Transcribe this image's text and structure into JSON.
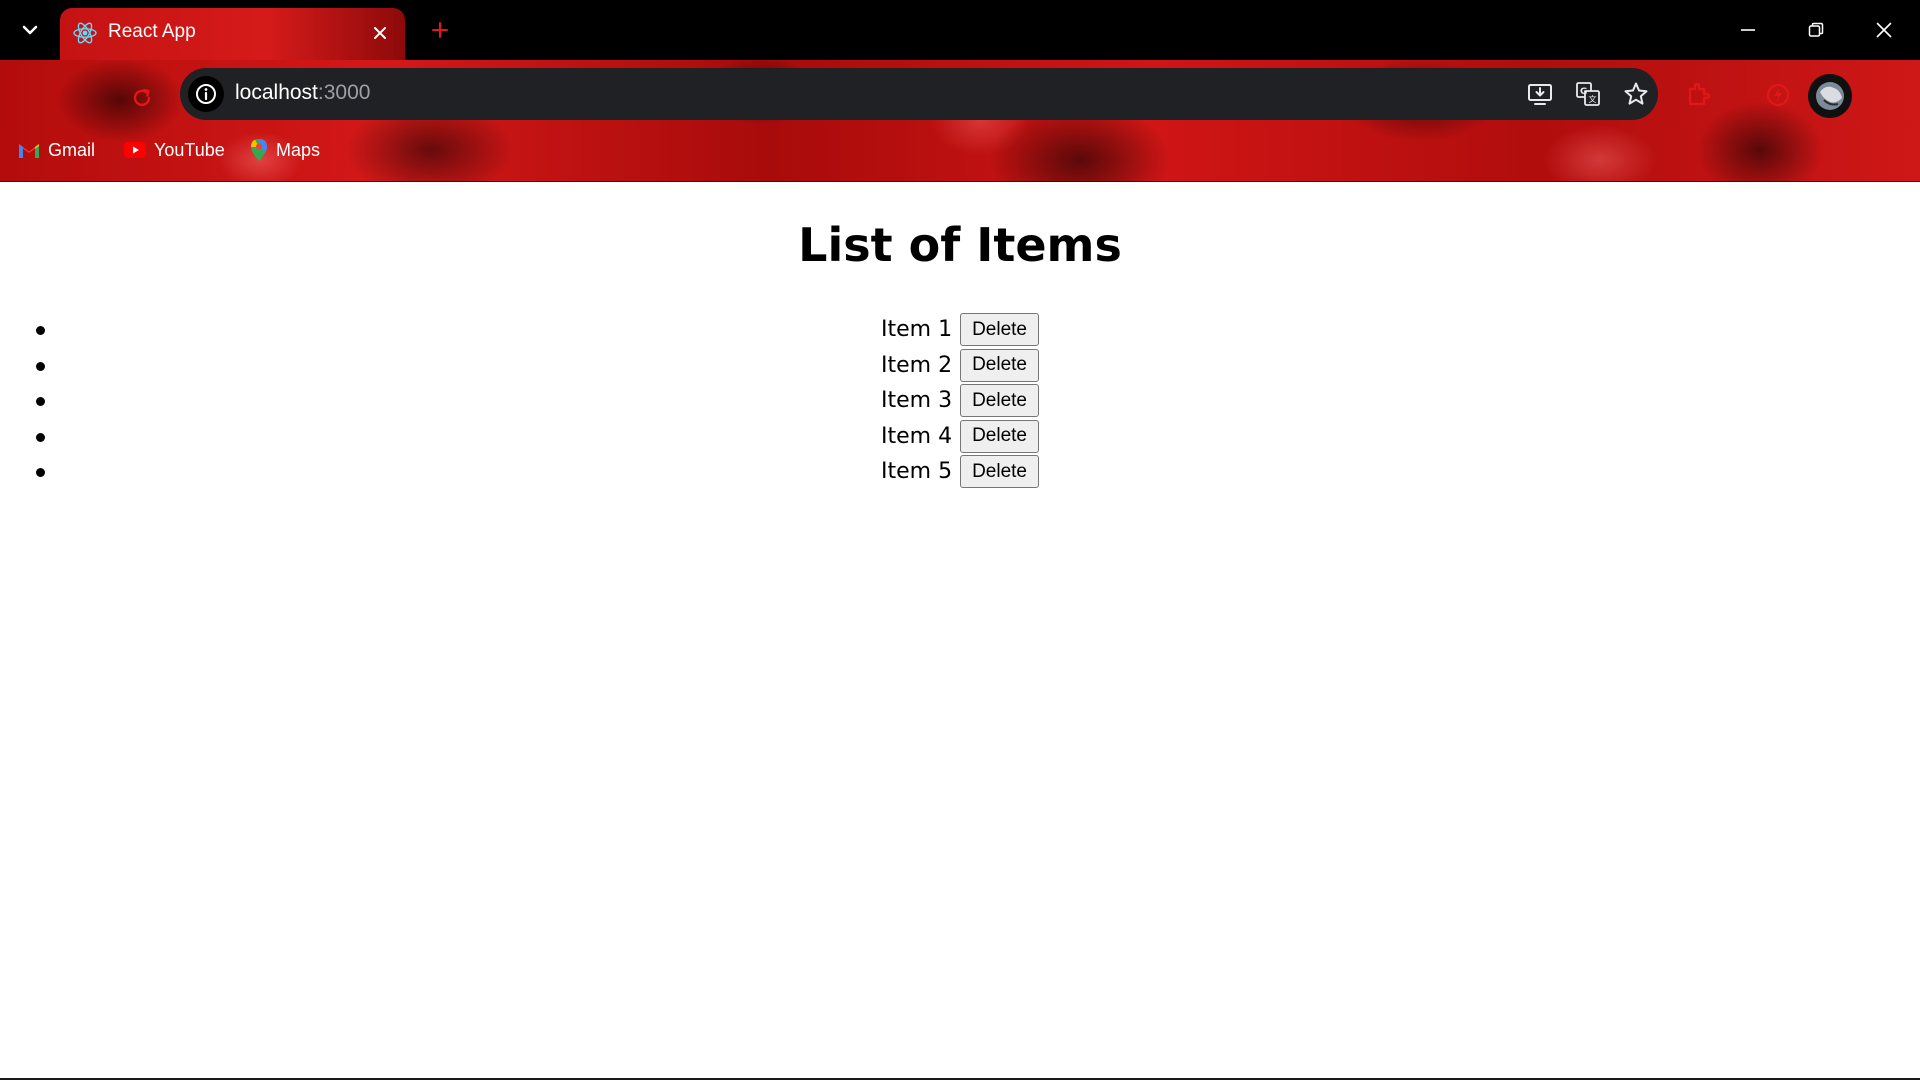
{
  "browser": {
    "tab": {
      "title": "React App",
      "favicon": "react-logo-icon",
      "close_icon": "close-icon"
    },
    "new_tab_icon": "plus-icon",
    "tab_search_icon": "chevron-down-icon",
    "window_controls": [
      "minimize-icon",
      "restore-icon",
      "close-icon"
    ],
    "omnibox": {
      "site_info_icon": "info-icon",
      "url_host": "localhost",
      "url_port": ":3000",
      "icons": [
        "install-app-icon",
        "translate-icon",
        "star-icon"
      ]
    },
    "toolbar_icons": [
      "extension-icon",
      "performance-icon",
      "profile-avatar"
    ],
    "bookmarks": [
      {
        "label": "Gmail",
        "icon": "gmail-icon"
      },
      {
        "label": "YouTube",
        "icon": "youtube-icon"
      },
      {
        "label": "Maps",
        "icon": "maps-icon"
      }
    ],
    "theme_colors": {
      "titlebar": "#000000",
      "theme_red": "#c41212",
      "omnibox_bg": "#202124",
      "port_text": "#9aa0a6"
    }
  },
  "page": {
    "title": "List of Items",
    "items": [
      {
        "label": "Item 1",
        "button": "Delete"
      },
      {
        "label": "Item 2",
        "button": "Delete"
      },
      {
        "label": "Item 3",
        "button": "Delete"
      },
      {
        "label": "Item 4",
        "button": "Delete"
      },
      {
        "label": "Item 5",
        "button": "Delete"
      }
    ]
  }
}
